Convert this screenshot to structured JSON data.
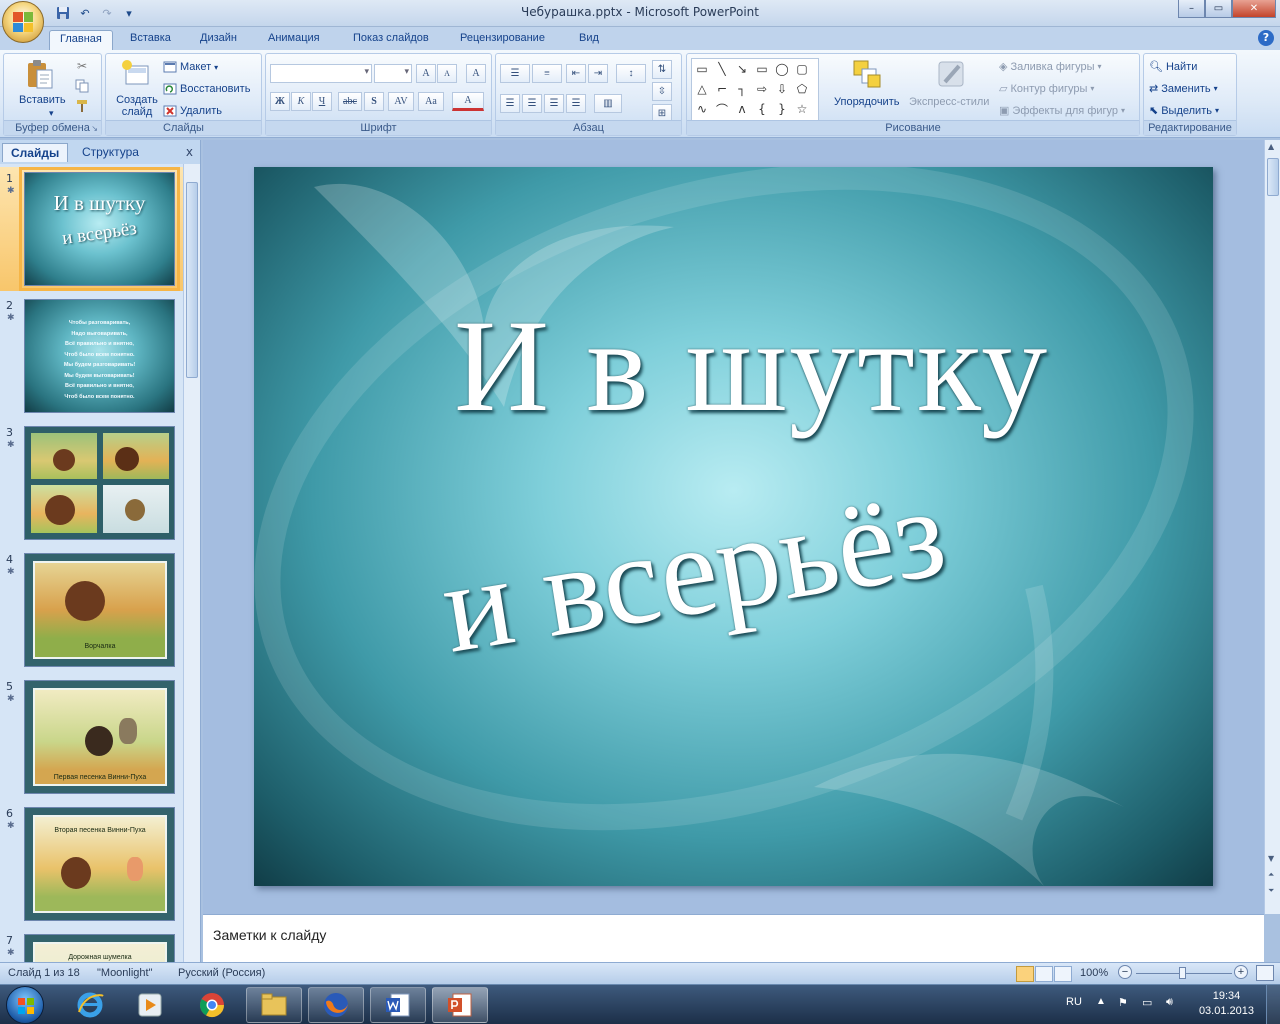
{
  "window": {
    "title": "Чебурашка.pptx - Microsoft PowerPoint",
    "minimize": "–",
    "restore": "▭",
    "close": "✕"
  },
  "qat": {
    "save": "save-icon",
    "undo": "↶",
    "redo": "↷",
    "more": "▾"
  },
  "tabs": [
    "Главная",
    "Вставка",
    "Дизайн",
    "Анимация",
    "Показ слайдов",
    "Рецензирование",
    "Вид"
  ],
  "active_tab": "Главная",
  "help": "?",
  "ribbon": {
    "clipboard": {
      "label": "Буфер обмена",
      "paste": "Вставить"
    },
    "slides": {
      "label": "Слайды",
      "new_slide": "Создать слайд",
      "layout": "Макет",
      "reset": "Восстановить",
      "delete": "Удалить"
    },
    "font": {
      "label": "Шрифт",
      "bold": "Ж",
      "italic": "К",
      "underline": "Ч",
      "strike": "abc",
      "shadow": "S",
      "spacing": "AV",
      "case": "Aa",
      "grow": "A",
      "shrink": "A",
      "clear": "A",
      "color": "A"
    },
    "paragraph": {
      "label": "Абзац"
    },
    "drawing": {
      "label": "Рисование",
      "arrange": "Упорядочить",
      "quick_styles": "Экспресс-стили",
      "fill": "Заливка фигуры",
      "outline": "Контур фигуры",
      "effects": "Эффекты для фигур"
    },
    "editing": {
      "label": "Редактирование",
      "find": "Найти",
      "replace": "Заменить",
      "select": "Выделить"
    }
  },
  "panel": {
    "tab_slides": "Слайды",
    "tab_outline": "Структура",
    "close": "x"
  },
  "thumbnails": [
    {
      "num": "1",
      "title_line1": "И в шутку",
      "title_line2": "и всерьёз"
    },
    {
      "num": "2",
      "lines": [
        "Чтобы разговаривать,",
        "Надо выговаривать,",
        "Всё правильно и внятно,",
        "Чтоб было всем понятно.",
        "Мы будем разговаривать!",
        "Мы будем выговаривать!",
        "Всё правильно и внятно,",
        "Чтоб было всем понятно."
      ]
    },
    {
      "num": "3"
    },
    {
      "num": "4",
      "caption": "Ворчалка"
    },
    {
      "num": "5",
      "caption": "Первая песенка Винни-Пуха"
    },
    {
      "num": "6",
      "caption": "Вторая песенка Винни-Пуха"
    },
    {
      "num": "7",
      "caption": "Дорожная шумелка"
    }
  ],
  "slide": {
    "line1": "И в шутку",
    "line2": "и всерьёз"
  },
  "notes": {
    "placeholder": "Заметки к слайду"
  },
  "status": {
    "slide_pos": "Слайд 1 из 18",
    "theme": "\"Moonlight\"",
    "language": "Русский (Россия)",
    "zoom": "100%",
    "zoom_minus": "−",
    "zoom_plus": "+"
  },
  "taskbar": {
    "lang": "RU",
    "time": "19:34",
    "date": "03.01.2013"
  },
  "colors": {
    "ribbon_bg": "#dde9f7",
    "accent": "#15428b",
    "selection": "#f8c66b",
    "slide_teal": "#3f9aa8"
  }
}
